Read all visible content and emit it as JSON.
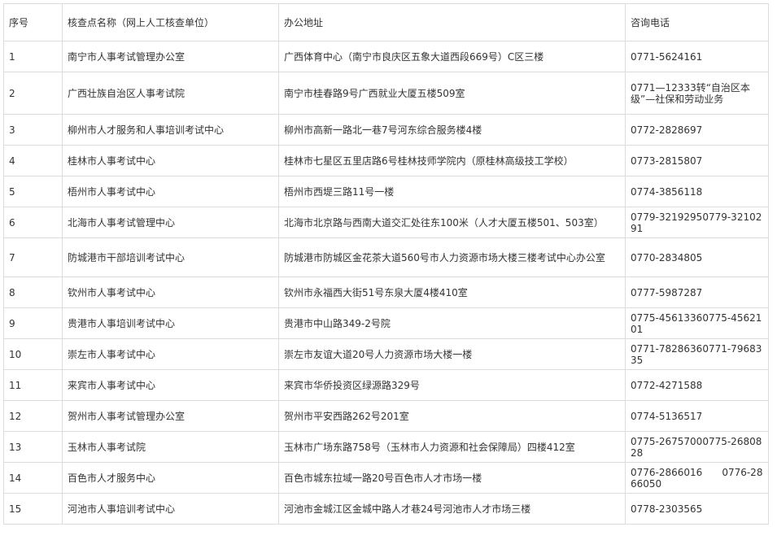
{
  "table": {
    "headers": [
      "序号",
      "核查点名称（网上人工核查单位）",
      "办公地址",
      "咨询电话"
    ],
    "rows": [
      [
        "1",
        "南宁市人事考试管理办公室",
        "广西体育中心（南宁市良庆区五象大道西段669号）C区三楼",
        "0771-5624161"
      ],
      [
        "2",
        "广西壮族自治区人事考试院",
        "南宁市桂春路9号广西就业大厦五楼509室",
        "0771—12333转“自治区本级”—社保和劳动业务"
      ],
      [
        "3",
        "柳州市人才服务和人事培训考试中心",
        "柳州市高新一路北一巷7号河东综合服务楼4楼",
        "0772-2828697"
      ],
      [
        "4",
        "桂林市人事考试中心",
        "桂林市七星区五里店路6号桂林技师学院内（原桂林高级技工学校）",
        "0773-2815807"
      ],
      [
        "5",
        "梧州市人事考试中心",
        "梧州市西堤三路11号一楼",
        "0774-3856118"
      ],
      [
        "6",
        "北海市人事考试管理中心",
        "北海市北京路与西南大道交汇处往东100米（人才大厦五楼501、503室）",
        "0779-32192950779-3210291"
      ],
      [
        "7",
        "防城港市干部培训考试中心",
        "防城港市防城区金花茶大道560号市人力资源市场大楼三楼考试中心办公室",
        "0770-2834805"
      ],
      [
        "8",
        "钦州市人事考试中心",
        "钦州市永福西大街51号东泉大厦4楼410室",
        "0777-5987287"
      ],
      [
        "9",
        "贵港市人事培训考试中心",
        "贵港市中山路349-2号院",
        "0775-45613360775-4562101"
      ],
      [
        "10",
        "崇左市人事考试中心",
        "崇左市友谊大道20号人力资源市场大楼一楼",
        "0771-78286360771-7968335"
      ],
      [
        "11",
        "来宾市人事考试中心",
        "来宾市华侨投资区绿源路329号",
        "0772-4271588"
      ],
      [
        "12",
        "贺州市人事考试管理办公室",
        "贺州市平安西路262号201室",
        "0774-5136517"
      ],
      [
        "13",
        "玉林市人事考试院",
        "玉林市广场东路758号（玉林市人力资源和社会保障局）四楼412室",
        "0775-26757000775-2680828"
      ],
      [
        "14",
        "百色市人才服务中心",
        "百色市城东拉域一路20号百色市人才市场一楼",
        "0776-2866016　　0776-2866050"
      ],
      [
        "15",
        "河池市人事培训考试中心",
        "河池市金城江区金城中路人才巷24号河池市人才市场三楼",
        "0778-2303565"
      ]
    ]
  }
}
